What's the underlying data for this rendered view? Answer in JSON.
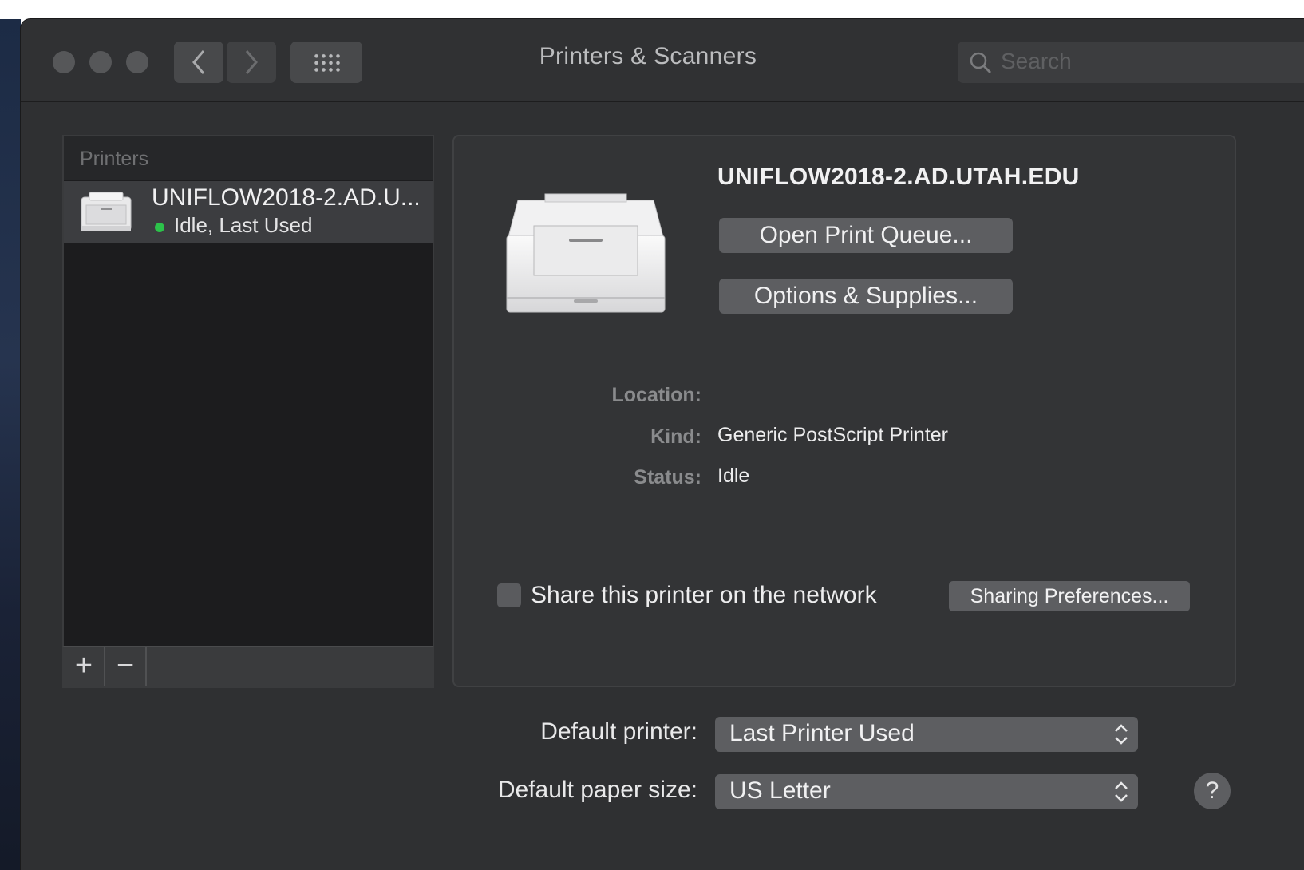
{
  "window": {
    "title": "Printers & Scanners",
    "search_placeholder": "Search"
  },
  "printer_list": {
    "header": "Printers",
    "items": [
      {
        "name": "UNIFLOW2018-2.AD.U...",
        "status": "Idle, Last Used",
        "status_color": "#2cc24a"
      }
    ],
    "add_label": "+",
    "remove_label": "−"
  },
  "detail": {
    "printer_name": "UNIFLOW2018-2.AD.UTAH.EDU",
    "open_queue_label": "Open Print Queue...",
    "options_label": "Options & Supplies...",
    "location_label": "Location:",
    "location_value": "",
    "kind_label": "Kind:",
    "kind_value": "Generic PostScript Printer",
    "status_label": "Status:",
    "status_value": "Idle",
    "share_label": "Share this printer on the network",
    "share_checked": false,
    "sharing_prefs_label": "Sharing Preferences..."
  },
  "defaults": {
    "default_printer_label": "Default printer:",
    "default_printer_value": "Last Printer Used",
    "paper_size_label": "Default paper size:",
    "paper_size_value": "US Letter"
  },
  "help_label": "?",
  "icons": [
    "back-icon",
    "forward-icon",
    "grid-icon",
    "search-icon",
    "printer-icon",
    "popup-arrows-icon"
  ]
}
